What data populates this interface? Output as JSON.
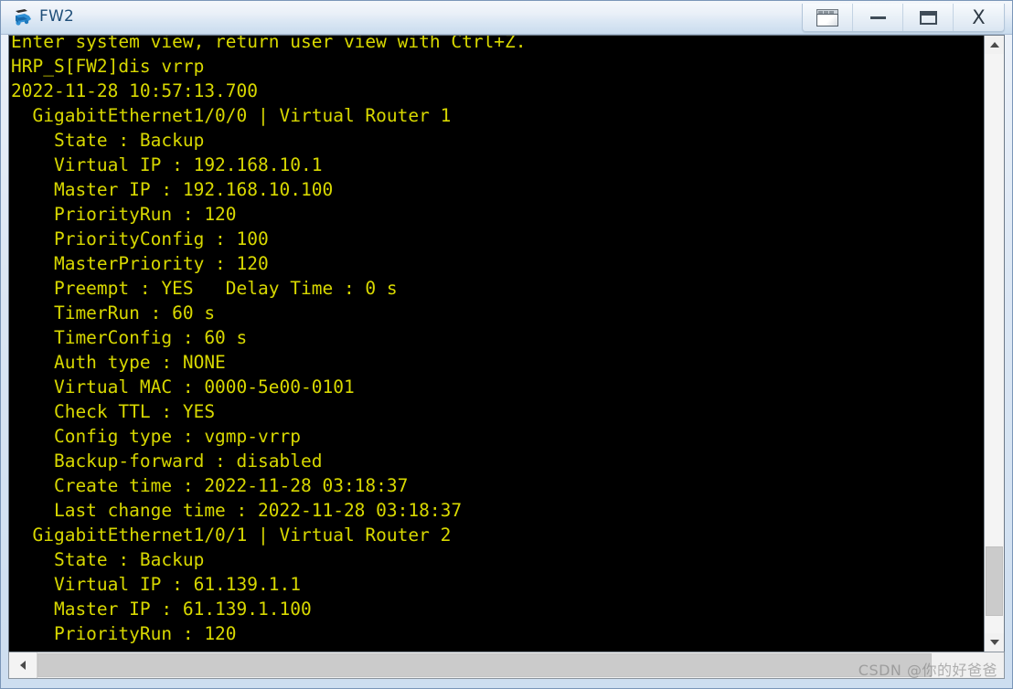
{
  "window": {
    "title": "FW2",
    "icon": "firewall-device-icon",
    "buttons": [
      {
        "name": "restore-down-button",
        "icon": "restore-window-icon",
        "label": ""
      },
      {
        "name": "minimize-button",
        "icon": "minimize-icon",
        "label": ""
      },
      {
        "name": "maximize-button",
        "icon": "maximize-icon",
        "label": ""
      },
      {
        "name": "close-button",
        "icon": "close-icon",
        "label": "X"
      }
    ]
  },
  "terminal": {
    "foreground_color": "#d8d800",
    "background_color": "#000000",
    "lines": [
      "Enter system view, return user view with Ctrl+Z.",
      "HRP_S[FW2]dis vrrp",
      "2022-11-28 10:57:13.700",
      "  GigabitEthernet1/0/0 | Virtual Router 1",
      "    State : Backup",
      "    Virtual IP : 192.168.10.1",
      "    Master IP : 192.168.10.100",
      "    PriorityRun : 120",
      "    PriorityConfig : 100",
      "    MasterPriority : 120",
      "    Preempt : YES   Delay Time : 0 s",
      "    TimerRun : 60 s",
      "    TimerConfig : 60 s",
      "    Auth type : NONE",
      "    Virtual MAC : 0000-5e00-0101",
      "    Check TTL : YES",
      "    Config type : vgmp-vrrp",
      "    Backup-forward : disabled",
      "    Create time : 2022-11-28 03:18:37",
      "    Last change time : 2022-11-28 03:18:37",
      "",
      "  GigabitEthernet1/0/1 | Virtual Router 2",
      "    State : Backup",
      "    Virtual IP : 61.139.1.1",
      "    Master IP : 61.139.1.100",
      "    PriorityRun : 120"
    ]
  },
  "scrollbars": {
    "vertical": {
      "up_icon": "chevron-up-icon",
      "down_icon": "chevron-down-icon",
      "thumb_top_percent": "85%",
      "thumb_height_percent": "12%"
    },
    "horizontal": {
      "left_icon": "chevron-left-icon",
      "thumb_width_percent": "92.5%"
    }
  },
  "watermark": {
    "text": "CSDN @你的好爸爸"
  }
}
